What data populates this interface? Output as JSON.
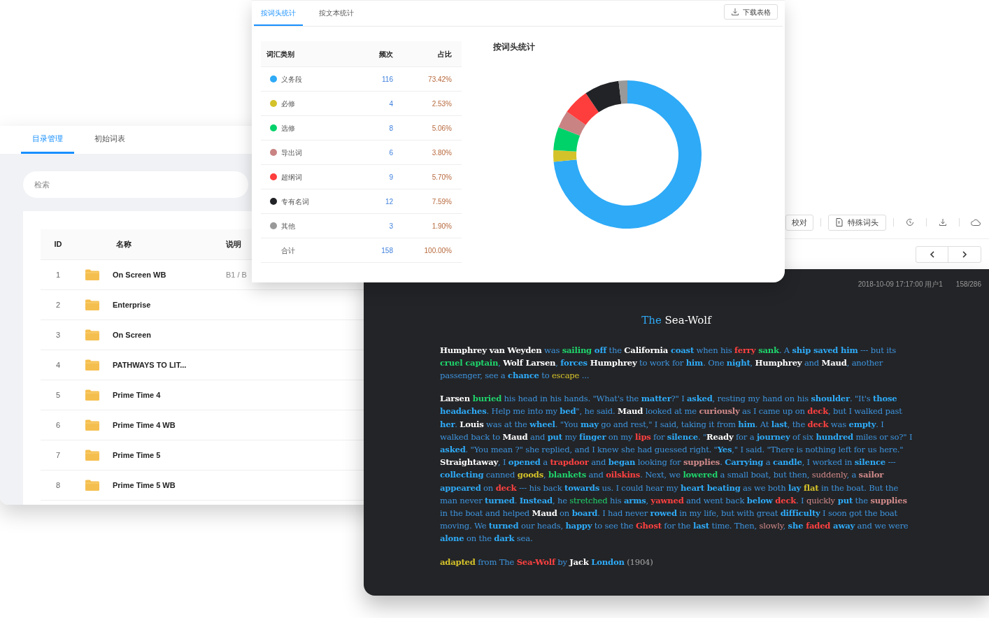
{
  "catalog_window": {
    "tabs": [
      {
        "label": "目录管理",
        "selected": true
      },
      {
        "label": "初始词表",
        "selected": false
      }
    ],
    "search": {
      "placeholder": "检索"
    },
    "table": {
      "columns": [
        "ID",
        "名称",
        "说明"
      ],
      "rows": [
        {
          "id": "1",
          "name": "On Screen WB",
          "description": "B1 / B"
        },
        {
          "id": "2",
          "name": "Enterprise"
        },
        {
          "id": "3",
          "name": "On Screen"
        },
        {
          "id": "4",
          "name": "PATHWAYS TO LIT..."
        },
        {
          "id": "5",
          "name": "Prime Time 4"
        },
        {
          "id": "6",
          "name": "Prime Time 4 WB"
        },
        {
          "id": "7",
          "name": "Prime Time 5"
        },
        {
          "id": "8",
          "name": "Prime Time 5 WB"
        }
      ]
    }
  },
  "stats_window": {
    "tabs": [
      {
        "label": "按词头统计",
        "selected": true
      },
      {
        "label": "按文本统计",
        "selected": false
      }
    ],
    "download_button": "下载表格",
    "table": {
      "columns": [
        "词汇类别",
        "频次",
        "占比"
      ],
      "rows": [
        {
          "count": "116",
          "share": "73.42%",
          "color": "#2eaaf7"
        },
        {
          "count": "4",
          "share": "2.53%",
          "color": "#d4c22a"
        },
        {
          "count": "8",
          "share": "5.06%",
          "color": "#00d26a"
        },
        {
          "count": "6",
          "share": "3.80%",
          "color": "#c98383"
        },
        {
          "count": "9",
          "share": "5.70%",
          "color": "#fe3d3d"
        },
        {
          "count": "12",
          "share": "7.59%",
          "color": "#222326"
        },
        {
          "count": "3",
          "share": "1.90%",
          "color": "#999999"
        }
      ],
      "total": {
        "label": "合计",
        "count": "158",
        "share": "100.00%"
      }
    },
    "chart_data": {
      "type": "donut",
      "title": "按词头统计",
      "legend": "left",
      "categories": [
        "义务段",
        "必修",
        "选修",
        "导出词",
        "超纲词",
        "专有名词",
        "其他"
      ],
      "values": [
        73.42,
        2.53,
        5.06,
        3.8,
        5.7,
        7.59,
        1.9
      ]
    }
  },
  "reader_window": {
    "toolbar_buttons": [
      "校对",
      "特殊词头"
    ],
    "timestamp": "2018-10-09 17:17:00 用户1",
    "page": "158/286",
    "title": [
      {
        "text": "The",
        "kind": "core"
      },
      {
        "text": " Sea-Wolf",
        "kind": "proper"
      }
    ],
    "paragraphs": [
      [
        {
          "text": "Humphrey van Weyden",
          "kind": "proper"
        },
        {
          "text": " was ",
          "kind": "plain"
        },
        {
          "text": "sailing",
          "kind": "elective"
        },
        {
          "text": " off",
          "kind": "core"
        },
        {
          "text": " the ",
          "kind": "plain"
        },
        {
          "text": "California",
          "kind": "proper"
        },
        {
          "text": " coast",
          "kind": "core"
        },
        {
          "text": " when his ",
          "kind": "plain"
        },
        {
          "text": "ferry",
          "kind": "beyond"
        },
        {
          "text": " sank",
          "kind": "elective"
        },
        {
          "text": ". A ",
          "kind": "plain"
        },
        {
          "text": "ship saved him",
          "kind": "core"
        },
        {
          "text": " --- but its ",
          "kind": "plain"
        },
        {
          "text": "cruel captain",
          "kind": "elective"
        },
        {
          "text": ", ",
          "kind": "plain"
        },
        {
          "text": "Wolf Larsen",
          "kind": "proper"
        },
        {
          "text": ", ",
          "kind": "plain"
        },
        {
          "text": "forces",
          "kind": "core"
        },
        {
          "text": " Humphrey",
          "kind": "proper"
        },
        {
          "text": " to work for ",
          "kind": "plain"
        },
        {
          "text": "him",
          "kind": "core"
        },
        {
          "text": ". One ",
          "kind": "plain"
        },
        {
          "text": "night",
          "kind": "core"
        },
        {
          "text": ", ",
          "kind": "plain"
        },
        {
          "text": "Humphrey",
          "kind": "proper"
        },
        {
          "text": " and ",
          "kind": "plain"
        },
        {
          "text": "Maud",
          "kind": "proper"
        },
        {
          "text": ", another passenger, see a ",
          "kind": "plain"
        },
        {
          "text": "chance",
          "kind": "core"
        },
        {
          "text": " to ",
          "kind": "plain"
        },
        {
          "text": "escape",
          "kind": "required",
          "bold": false
        },
        {
          "text": " ...",
          "kind": "plain"
        }
      ],
      [
        {
          "text": "Larsen",
          "kind": "proper"
        },
        {
          "text": " buried",
          "kind": "elective"
        },
        {
          "text": " his head in his hands. \"What's the ",
          "kind": "plain"
        },
        {
          "text": "matter",
          "kind": "core"
        },
        {
          "text": "?\" I ",
          "kind": "plain"
        },
        {
          "text": "asked",
          "kind": "core"
        },
        {
          "text": ", resting my hand on his ",
          "kind": "plain"
        },
        {
          "text": "shoulder",
          "kind": "core"
        },
        {
          "text": ". \"It's ",
          "kind": "plain"
        },
        {
          "text": "those headaches",
          "kind": "core"
        },
        {
          "text": ". Help me into my ",
          "kind": "plain"
        },
        {
          "text": "bed",
          "kind": "core"
        },
        {
          "text": "\", he said. ",
          "kind": "plain"
        },
        {
          "text": "Maud",
          "kind": "proper"
        },
        {
          "text": " looked at me ",
          "kind": "plain"
        },
        {
          "text": "curiously",
          "kind": "derived"
        },
        {
          "text": " as I came up on ",
          "kind": "plain"
        },
        {
          "text": "deck",
          "kind": "beyond"
        },
        {
          "text": ", but I walked past ",
          "kind": "plain"
        },
        {
          "text": "her",
          "kind": "core"
        },
        {
          "text": ". ",
          "kind": "plain"
        },
        {
          "text": "Louis",
          "kind": "proper"
        },
        {
          "text": " was at the ",
          "kind": "plain"
        },
        {
          "text": "wheel",
          "kind": "core"
        },
        {
          "text": ". \"You ",
          "kind": "plain"
        },
        {
          "text": "may",
          "kind": "core"
        },
        {
          "text": " go and rest,\" I said, taking it from ",
          "kind": "plain"
        },
        {
          "text": "him",
          "kind": "core"
        },
        {
          "text": ". At ",
          "kind": "plain"
        },
        {
          "text": "last",
          "kind": "core"
        },
        {
          "text": ", the ",
          "kind": "plain"
        },
        {
          "text": "deck",
          "kind": "beyond"
        },
        {
          "text": " was ",
          "kind": "plain"
        },
        {
          "text": "empty",
          "kind": "core"
        },
        {
          "text": ". I walked back to ",
          "kind": "plain"
        },
        {
          "text": "Maud",
          "kind": "proper"
        },
        {
          "text": " and ",
          "kind": "plain"
        },
        {
          "text": "put",
          "kind": "core"
        },
        {
          "text": " my ",
          "kind": "plain"
        },
        {
          "text": "finger",
          "kind": "core"
        },
        {
          "text": " on my ",
          "kind": "plain"
        },
        {
          "text": "lips",
          "kind": "beyond"
        },
        {
          "text": " for ",
          "kind": "plain"
        },
        {
          "text": "silence",
          "kind": "core"
        },
        {
          "text": ". \"",
          "kind": "plain"
        },
        {
          "text": "Ready",
          "kind": "proper"
        },
        {
          "text": " for a ",
          "kind": "plain"
        },
        {
          "text": "journey",
          "kind": "core"
        },
        {
          "text": " of six ",
          "kind": "plain"
        },
        {
          "text": "hundred",
          "kind": "core"
        },
        {
          "text": " miles or so?\" I ",
          "kind": "plain"
        },
        {
          "text": "asked",
          "kind": "core"
        },
        {
          "text": ". \"You mean ?\" she replied, and I knew she had guessed right. \"",
          "kind": "plain"
        },
        {
          "text": "Yes",
          "kind": "core"
        },
        {
          "text": ",\" I said. \"There is nothing left for us here.\" ",
          "kind": "plain"
        },
        {
          "text": "Straightaway",
          "kind": "proper"
        },
        {
          "text": ", I ",
          "kind": "plain"
        },
        {
          "text": "opened",
          "kind": "core"
        },
        {
          "text": " a ",
          "kind": "plain"
        },
        {
          "text": "trapdoor",
          "kind": "beyond"
        },
        {
          "text": " and ",
          "kind": "plain"
        },
        {
          "text": "began",
          "kind": "core"
        },
        {
          "text": " looking for ",
          "kind": "plain"
        },
        {
          "text": "supplies",
          "kind": "derived"
        },
        {
          "text": ". ",
          "kind": "plain"
        },
        {
          "text": "Carrying",
          "kind": "core"
        },
        {
          "text": " a ",
          "kind": "plain"
        },
        {
          "text": "candle",
          "kind": "core"
        },
        {
          "text": ", I worked in ",
          "kind": "plain"
        },
        {
          "text": "silence",
          "kind": "core"
        },
        {
          "text": " --- ",
          "kind": "plain"
        },
        {
          "text": "collecting",
          "kind": "core"
        },
        {
          "text": " canned ",
          "kind": "plain"
        },
        {
          "text": "goods",
          "kind": "required"
        },
        {
          "text": ", ",
          "kind": "plain"
        },
        {
          "text": "blankets",
          "kind": "elective"
        },
        {
          "text": " and ",
          "kind": "plain"
        },
        {
          "text": "oilskins",
          "kind": "beyond"
        },
        {
          "text": ". Next, we ",
          "kind": "plain"
        },
        {
          "text": "lowered",
          "kind": "elective"
        },
        {
          "text": " a small boat, but then, ",
          "kind": "plain"
        },
        {
          "text": "suddenly",
          "kind": "derived",
          "bold": false
        },
        {
          "text": ", a ",
          "kind": "plain"
        },
        {
          "text": "sailor",
          "kind": "derived"
        },
        {
          "text": " appeared",
          "kind": "core"
        },
        {
          "text": " on ",
          "kind": "plain"
        },
        {
          "text": "deck",
          "kind": "beyond"
        },
        {
          "text": " --- his back ",
          "kind": "plain"
        },
        {
          "text": "towards",
          "kind": "core"
        },
        {
          "text": " us. I could hear my ",
          "kind": "plain"
        },
        {
          "text": "heart beating",
          "kind": "core"
        },
        {
          "text": " as we both ",
          "kind": "plain"
        },
        {
          "text": "lay",
          "kind": "core"
        },
        {
          "text": " flat",
          "kind": "required"
        },
        {
          "text": " in the boat. But the man never ",
          "kind": "plain"
        },
        {
          "text": "turned",
          "kind": "core"
        },
        {
          "text": ". ",
          "kind": "plain"
        },
        {
          "text": "Instead",
          "kind": "core"
        },
        {
          "text": ", he ",
          "kind": "plain"
        },
        {
          "text": "stretched",
          "kind": "elective",
          "bold": false
        },
        {
          "text": " his ",
          "kind": "plain"
        },
        {
          "text": "arms",
          "kind": "core"
        },
        {
          "text": ", ",
          "kind": "plain"
        },
        {
          "text": "yawned",
          "kind": "beyond"
        },
        {
          "text": " and went back ",
          "kind": "plain"
        },
        {
          "text": "below",
          "kind": "core"
        },
        {
          "text": " deck",
          "kind": "beyond"
        },
        {
          "text": ". I ",
          "kind": "plain"
        },
        {
          "text": "quickly",
          "kind": "derived",
          "bold": false
        },
        {
          "text": " put",
          "kind": "core"
        },
        {
          "text": " the ",
          "kind": "plain"
        },
        {
          "text": "supplies",
          "kind": "derived"
        },
        {
          "text": " in the boat and helped ",
          "kind": "plain"
        },
        {
          "text": "Maud",
          "kind": "proper"
        },
        {
          "text": " on ",
          "kind": "plain"
        },
        {
          "text": "board",
          "kind": "core"
        },
        {
          "text": ". I had never ",
          "kind": "plain"
        },
        {
          "text": "rowed",
          "kind": "core"
        },
        {
          "text": " in my life, but with great ",
          "kind": "plain"
        },
        {
          "text": "difficulty",
          "kind": "core"
        },
        {
          "text": " I soon got the boat moving. We ",
          "kind": "plain"
        },
        {
          "text": "turned",
          "kind": "core"
        },
        {
          "text": " our heads, ",
          "kind": "plain"
        },
        {
          "text": "happy",
          "kind": "core"
        },
        {
          "text": " to see the ",
          "kind": "plain"
        },
        {
          "text": "Ghost",
          "kind": "beyond"
        },
        {
          "text": " for the ",
          "kind": "plain"
        },
        {
          "text": "last",
          "kind": "core"
        },
        {
          "text": " time. Then, ",
          "kind": "plain"
        },
        {
          "text": "slowly",
          "kind": "derived",
          "bold": false
        },
        {
          "text": ", ",
          "kind": "plain"
        },
        {
          "text": "she",
          "kind": "core"
        },
        {
          "text": " faded",
          "kind": "beyond"
        },
        {
          "text": " away",
          "kind": "core"
        },
        {
          "text": " and we were ",
          "kind": "plain"
        },
        {
          "text": "alone",
          "kind": "core"
        },
        {
          "text": " on the ",
          "kind": "plain"
        },
        {
          "text": "dark",
          "kind": "core"
        },
        {
          "text": " sea.",
          "kind": "plain"
        }
      ],
      [
        {
          "text": "adapted",
          "kind": "required"
        },
        {
          "text": " from The ",
          "kind": "plain"
        },
        {
          "text": "Sea-Wolf",
          "kind": "beyond"
        },
        {
          "text": " by ",
          "kind": "plain"
        },
        {
          "text": "Jack",
          "kind": "proper"
        },
        {
          "text": " London",
          "kind": "core"
        },
        {
          "text": " (1904)",
          "kind": "other",
          "bold": false
        }
      ]
    ]
  }
}
